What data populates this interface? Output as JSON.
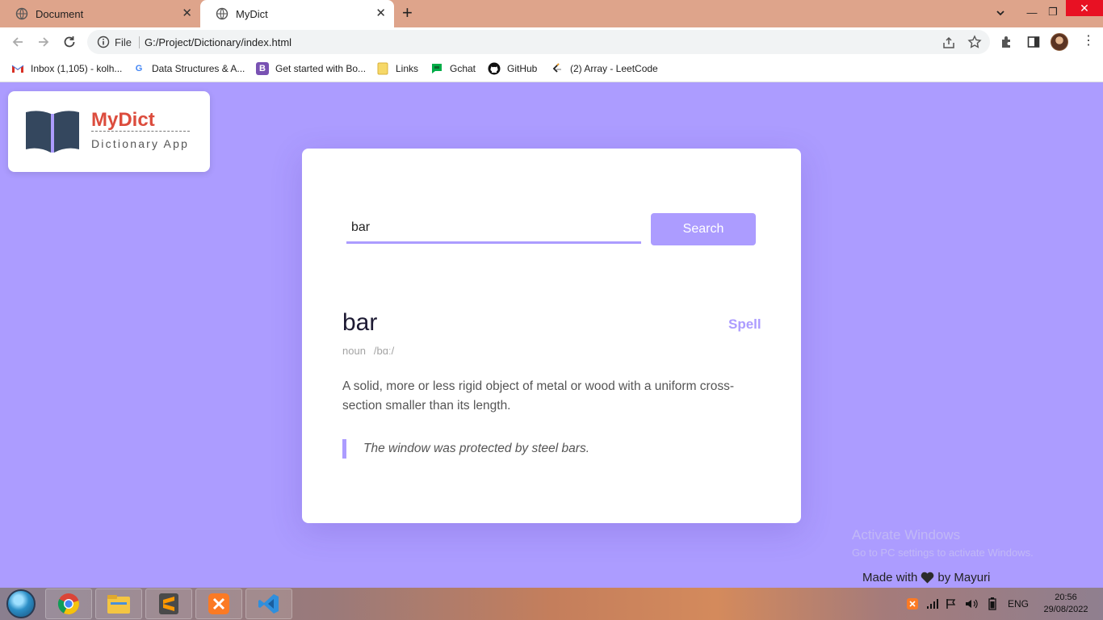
{
  "browser": {
    "tabs": [
      {
        "title": "Document"
      },
      {
        "title": "MyDict"
      }
    ],
    "address": {
      "security_label": "File",
      "url": "G:/Project/Dictionary/index.html"
    },
    "bookmarks": [
      {
        "label": "Inbox (1,105) - kolh...",
        "icon": "gmail-icon"
      },
      {
        "label": "Data Structures & A...",
        "icon": "google-icon"
      },
      {
        "label": "Get started with Bo...",
        "icon": "bootstrap-icon"
      },
      {
        "label": "Links",
        "icon": "folder-icon"
      },
      {
        "label": "Gchat",
        "icon": "chat-icon"
      },
      {
        "label": "GitHub",
        "icon": "github-icon"
      },
      {
        "label": "(2) Array - LeetCode",
        "icon": "leetcode-icon"
      }
    ]
  },
  "logo": {
    "title": "MyDict",
    "subtitle": "Dictionary App"
  },
  "search": {
    "value": "bar",
    "button": "Search"
  },
  "result": {
    "word": "bar",
    "spell": "Spell",
    "part_of_speech": "noun",
    "phonetic": "/bɑː/",
    "meaning": "A solid, more or less rigid object of metal or wood with a uniform cross-section smaller than its length.",
    "example": "The window was protected by steel bars."
  },
  "watermark": {
    "title": "Activate Windows",
    "subtitle": "Go to PC settings to activate Windows."
  },
  "footer": {
    "prefix": "Made with",
    "suffix": "by Mayuri"
  },
  "taskbar": {
    "apps": [
      "chrome-icon",
      "file-explorer-icon",
      "sublime-text-icon",
      "xampp-icon",
      "vscode-icon"
    ],
    "language": "ENG",
    "time": "20:56",
    "date": "29/08/2022"
  },
  "colors": {
    "background": "#ac9cff",
    "accent": "#ac9cff",
    "logo_red": "#dc4c3d",
    "tabbar": "#dea48b"
  }
}
